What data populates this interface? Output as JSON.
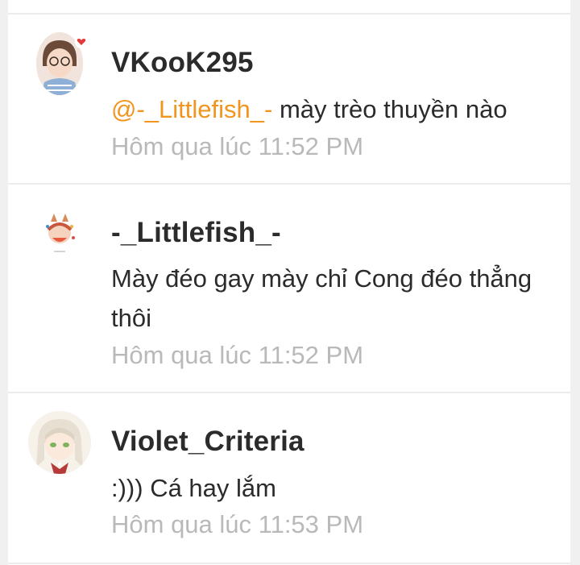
{
  "comments": [
    {
      "username": "VKooK295",
      "mention": "@-_Littlefish_-",
      "text": " mày trèo thuyền nào",
      "time": "Hôm qua lúc 11:52 PM"
    },
    {
      "username": "-_Littlefish_-",
      "text": "Mày đéo gay mày chỉ Cong đéo thẳng thôi",
      "time": "Hôm qua lúc 11:52 PM"
    },
    {
      "username": "Violet_Criteria",
      "text": ":))) Cá hay lắm",
      "time": "Hôm qua lúc 11:53 PM"
    }
  ],
  "colors": {
    "mention": "#f2951f",
    "username": "#2b2b2b",
    "timestamp": "#b9b9b9"
  }
}
